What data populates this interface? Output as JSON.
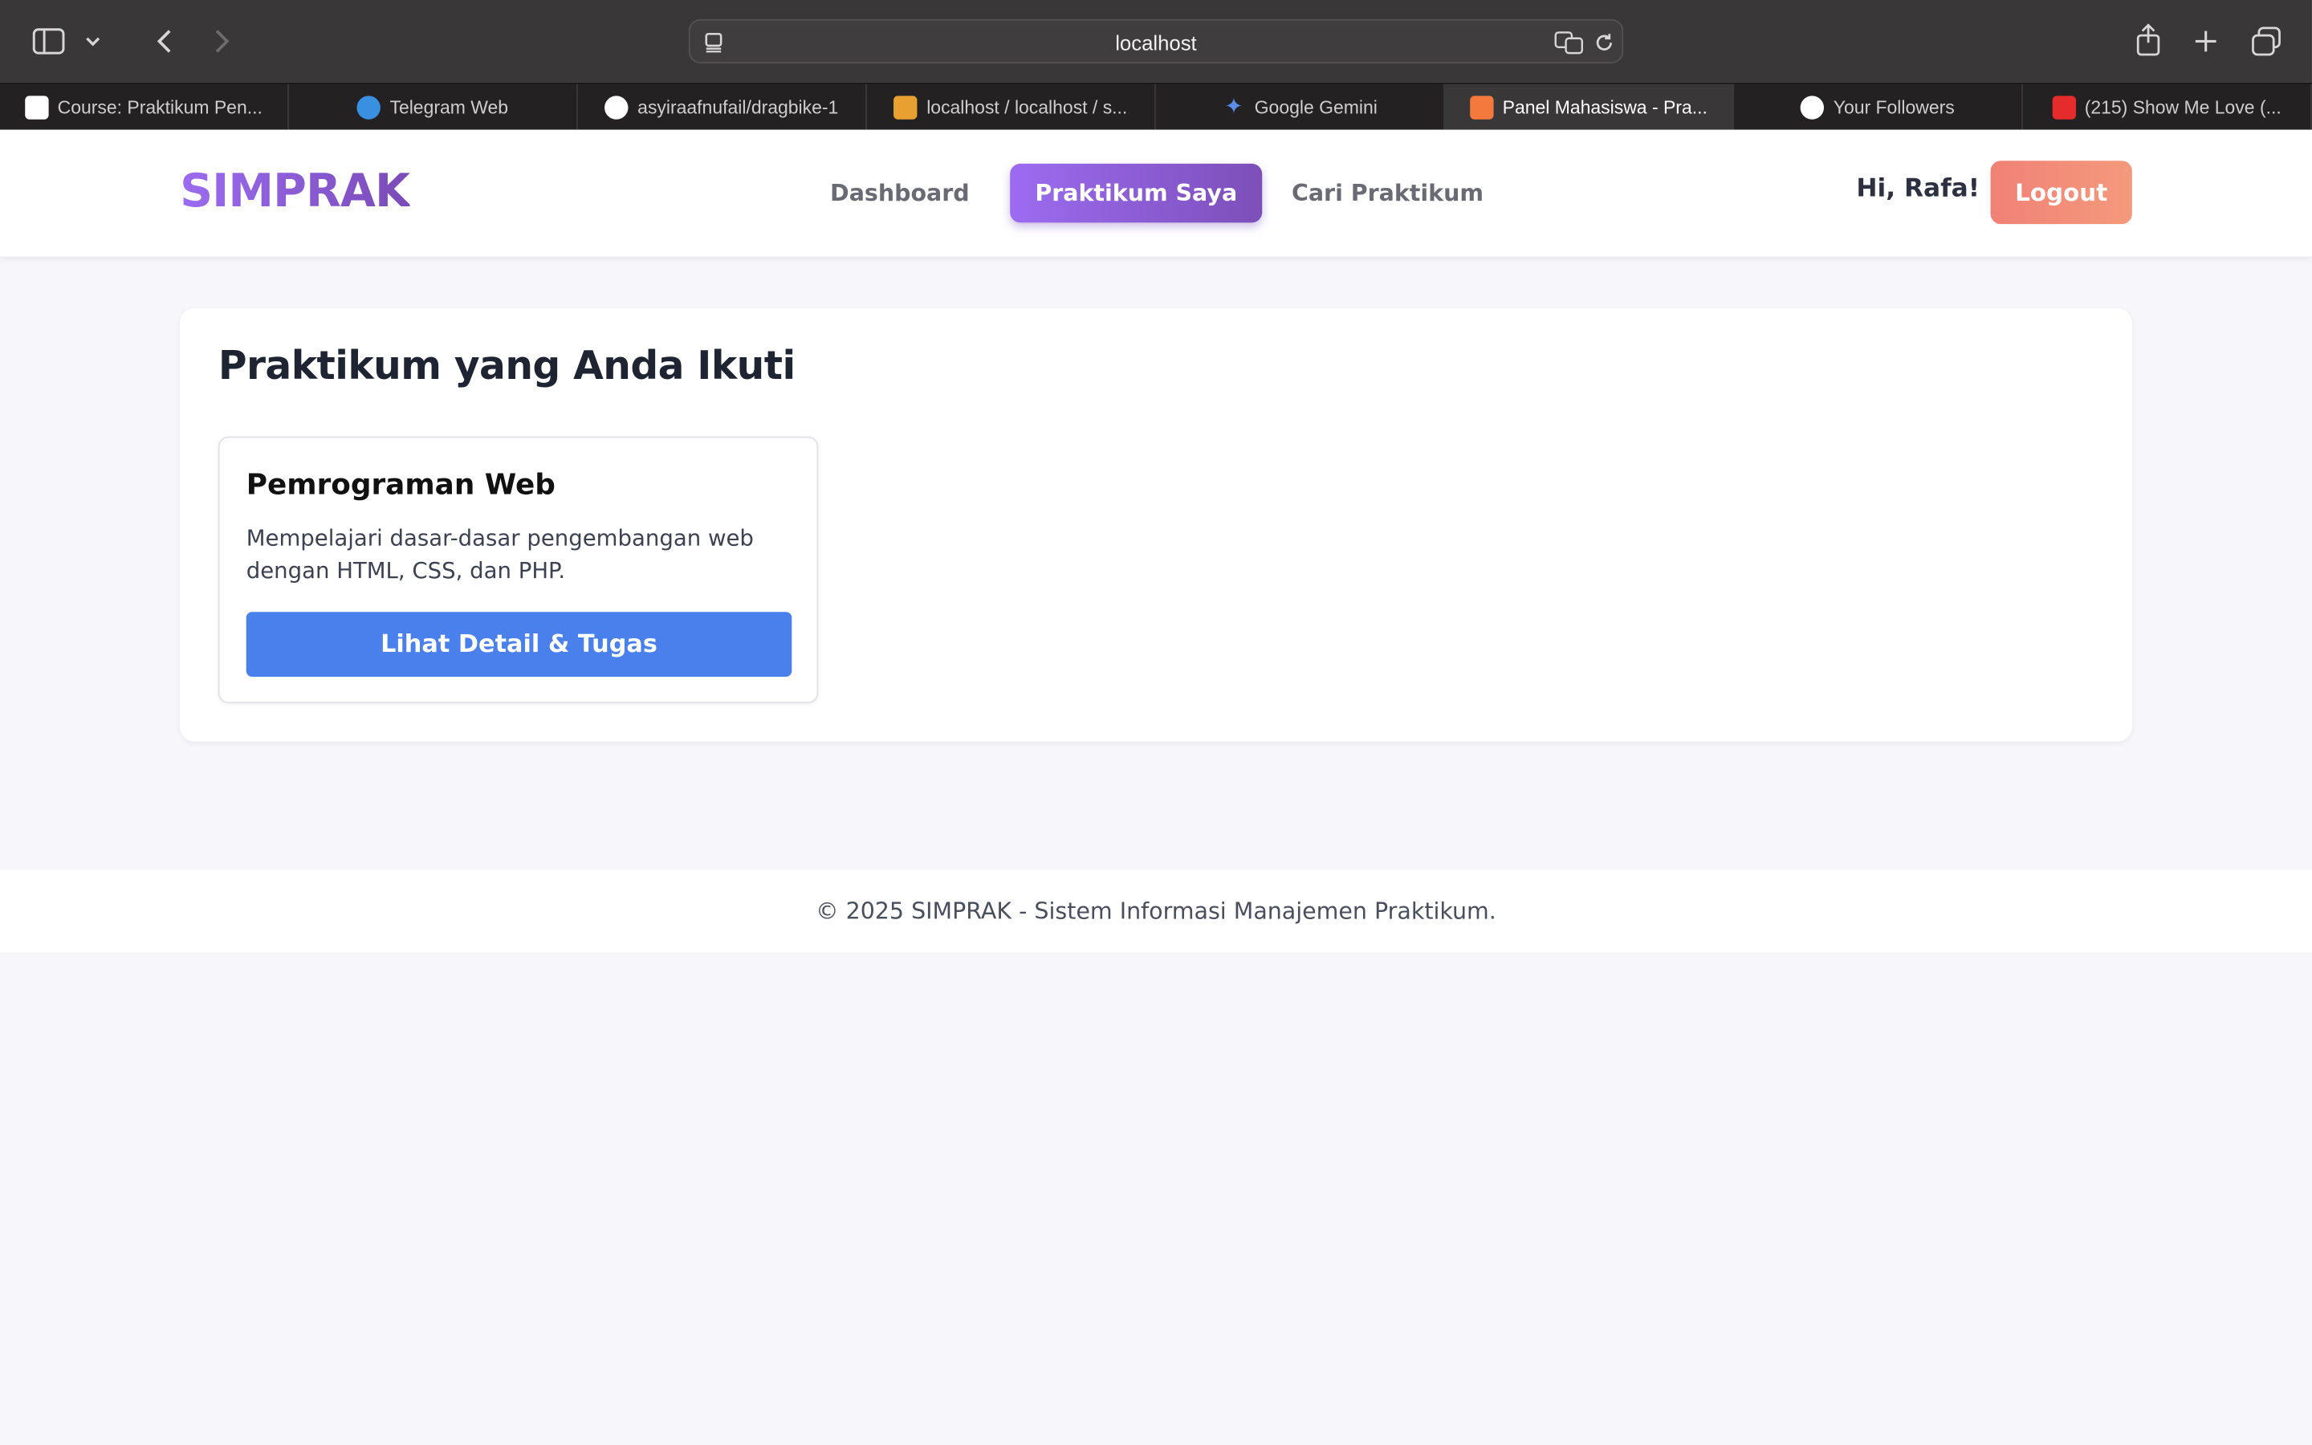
{
  "browser": {
    "url": "localhost",
    "tabs": [
      {
        "label": "Course: Praktikum Pen...",
        "icon": "moodle-icon",
        "color": "#ffffff"
      },
      {
        "label": "Telegram Web",
        "icon": "telegram-icon",
        "color": "#3a90e0"
      },
      {
        "label": "asyiraafnufail/dragbike-1",
        "icon": "github-icon",
        "color": "#ffffff"
      },
      {
        "label": "localhost / localhost / s...",
        "icon": "phpmyadmin-icon",
        "color": "#e8a030"
      },
      {
        "label": "Google Gemini",
        "icon": "gemini-icon",
        "color": "#5b8def"
      },
      {
        "label": "Panel Mahasiswa - Pra...",
        "icon": "xampp-icon",
        "color": "#f37a3c"
      },
      {
        "label": "Your Followers",
        "icon": "github-icon",
        "color": "#ffffff"
      },
      {
        "label": "(215) Show Me Love (...",
        "icon": "youtube-icon",
        "color": "#e62b2b"
      }
    ]
  },
  "nav": {
    "brand": "SIMPRAK",
    "links": [
      "Dashboard",
      "Praktikum Saya",
      "Cari Praktikum"
    ],
    "greeting": "Hi, Rafa!",
    "logout": "Logout"
  },
  "main": {
    "title": "Praktikum yang Anda Ikuti",
    "course": {
      "title": "Pemrograman Web",
      "description": "Mempelajari dasar-dasar pengembangan web dengan HTML, CSS, dan PHP.",
      "button": "Lihat Detail & Tugas"
    }
  },
  "footer": {
    "text": "© 2025 SIMPRAK - Sistem Informasi Manajemen Praktikum."
  },
  "colors": {
    "brand_gradient_start": "#9b6cf0",
    "brand_gradient_end": "#7b4bb8",
    "logout": "#f08176",
    "primary_button": "#4a80ec",
    "page_background": "#f6f6fb"
  }
}
